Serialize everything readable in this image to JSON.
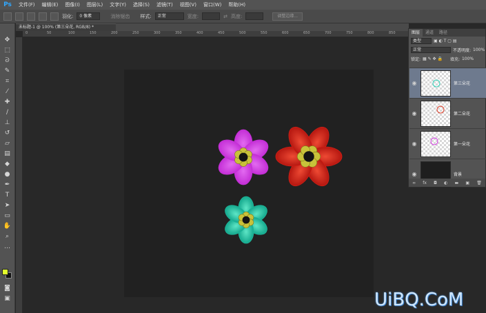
{
  "app": {
    "logo": "Ps"
  },
  "menu": [
    "文件(F)",
    "编辑(E)",
    "图像(I)",
    "图层(L)",
    "文字(Y)",
    "选择(S)",
    "滤镜(T)",
    "视图(V)",
    "窗口(W)",
    "帮助(H)"
  ],
  "options": {
    "feather_label": "羽化:",
    "feather_value": "0 像素",
    "antialias_label": "消除锯齿",
    "style_label": "样式:",
    "style_value": "正常",
    "width_label": "宽度:",
    "height_label": "高度:",
    "refine_button": "调整边缘..."
  },
  "document": {
    "tab_title": "未标题-1 @ 100% (第三朵花, RGB/8) *"
  },
  "ruler": {
    "labels": [
      "0",
      "50",
      "100",
      "150",
      "200",
      "250",
      "300",
      "350",
      "400",
      "450",
      "500",
      "550",
      "600",
      "650",
      "700",
      "750",
      "800",
      "850"
    ]
  },
  "layers_panel": {
    "tabs": [
      "图层",
      "通道",
      "路径"
    ],
    "filter_value": "类型",
    "blend_mode": "正常",
    "opacity_label": "不透明度:",
    "opacity_value": "100%",
    "lock_label": "锁定:",
    "fill_label": "填充:",
    "fill_value": "100%",
    "layers": [
      {
        "name": "第三朵花",
        "selected": true,
        "color": "#2fd1b8"
      },
      {
        "name": "第二朵花",
        "selected": false,
        "color": "#e0402a"
      },
      {
        "name": "第一朵花",
        "selected": false,
        "color": "#d23fe0"
      },
      {
        "name": "背景",
        "selected": false,
        "color": "#1e1e1e"
      }
    ],
    "footer_icons": [
      "link-icon",
      "fx-icon",
      "mask-icon",
      "adjustment-icon",
      "folder-icon",
      "new-layer-icon",
      "trash-icon"
    ]
  },
  "flowers": [
    {
      "name": "purple-flower",
      "petal": "#c42fd6",
      "petal_light": "#e26af0",
      "center": "#c8c23a"
    },
    {
      "name": "red-flower",
      "petal": "#d21f16",
      "petal_light": "#ee4a34",
      "center": "#c8c23a"
    },
    {
      "name": "cyan-flower",
      "petal": "#1fb89c",
      "petal_light": "#5ee6c6",
      "center": "#c8c23a"
    }
  ],
  "colors": {
    "foreground": "#e2ff2c",
    "background": "#111111"
  },
  "watermark": "UiBQ.CoM"
}
